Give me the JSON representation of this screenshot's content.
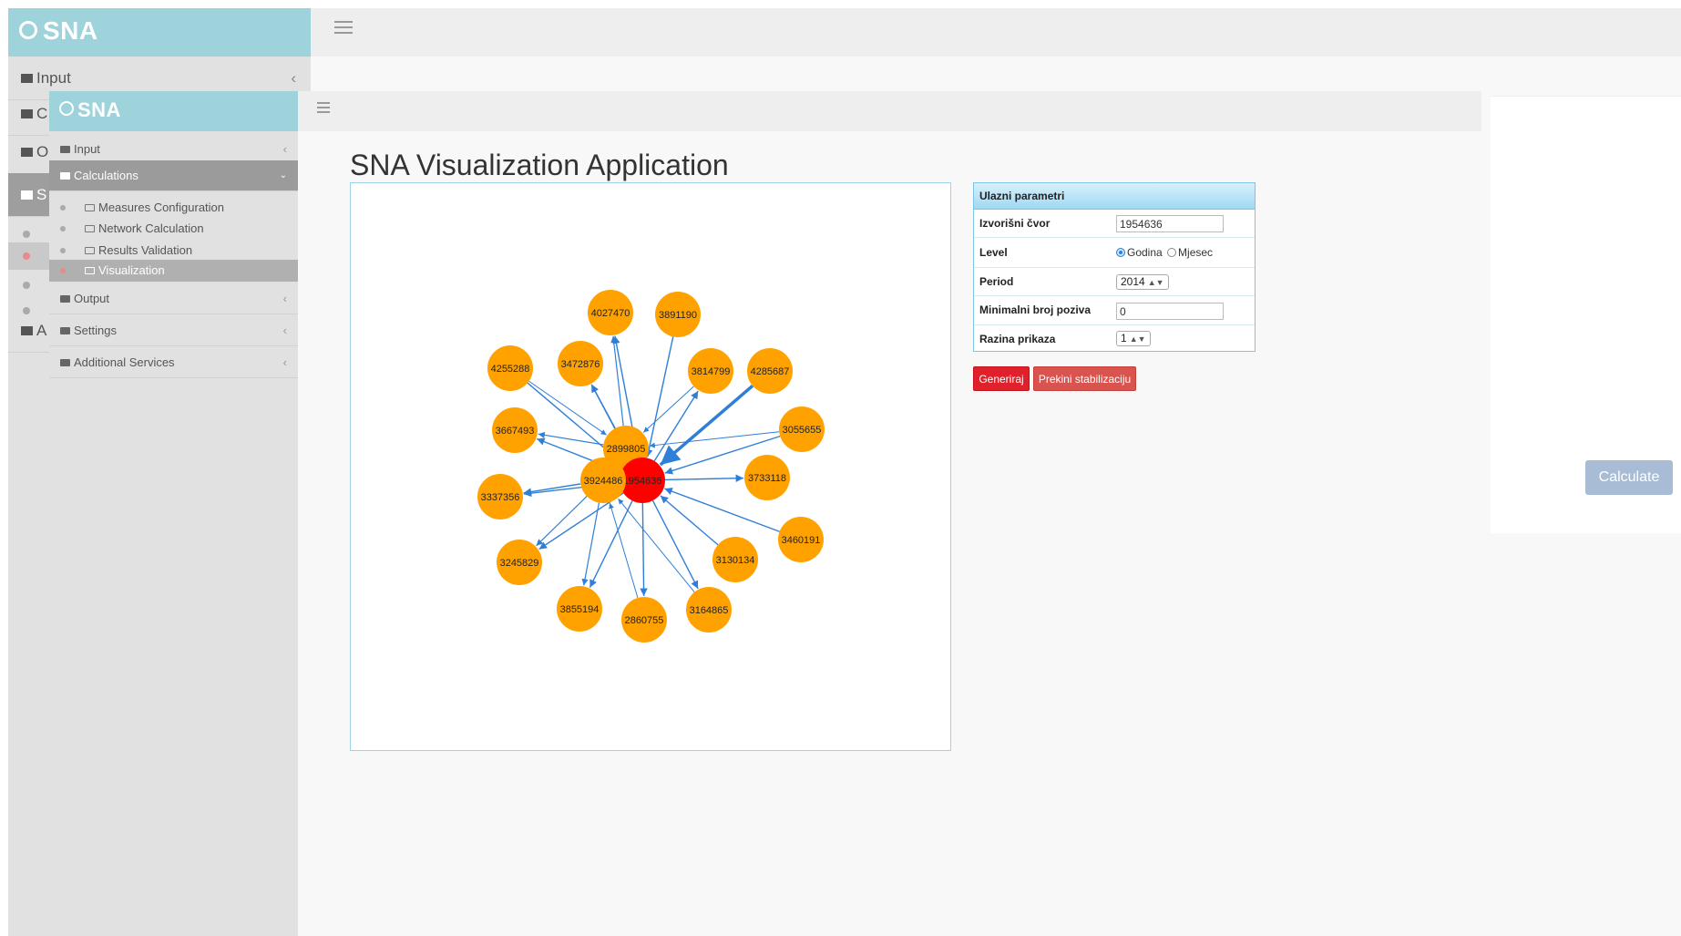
{
  "app": {
    "logo_text": "SNA",
    "page_title": "SNA Visualization Application"
  },
  "background_window": {
    "sidebar": [
      {
        "label": "Input"
      },
      {
        "label": "C"
      },
      {
        "label": "O"
      },
      {
        "label": "S"
      },
      {
        "label": "A"
      }
    ],
    "calculate_label": "Calculate"
  },
  "sidebar": {
    "items": [
      {
        "label": "Input",
        "expanded": false
      },
      {
        "label": "Calculations",
        "expanded": true
      },
      {
        "label": "Output",
        "expanded": false
      },
      {
        "label": "Settings",
        "expanded": false
      },
      {
        "label": "Additional Services",
        "expanded": false
      }
    ],
    "sub_items": [
      {
        "label": "Measures Configuration"
      },
      {
        "label": "Network Calculation"
      },
      {
        "label": "Results Validation"
      },
      {
        "label": "Visualization",
        "active": true
      }
    ]
  },
  "params": {
    "title": "Ulazni parametri",
    "source_node_label": "Izvorišni čvor",
    "source_node_value": "1954636",
    "level_label": "Level",
    "level_options": [
      "Godina",
      "Mjesec"
    ],
    "level_selected": "Godina",
    "period_label": "Period",
    "period_value": "2014",
    "min_calls_label": "Minimalni broj poziva",
    "min_calls_value": "0",
    "display_level_label": "Razina prikaza",
    "display_level_value": "1"
  },
  "buttons": {
    "generate": "Generiraj",
    "stop_stabilization": "Prekini stabilizaciju"
  },
  "graph": {
    "center": {
      "id": "1954636",
      "color": "#ff0000"
    },
    "node_color": "#ffa200",
    "edge_color": "#2f7fd8",
    "nodes": [
      {
        "id": "4027470"
      },
      {
        "id": "3891190"
      },
      {
        "id": "4255288"
      },
      {
        "id": "3472876"
      },
      {
        "id": "3814799"
      },
      {
        "id": "4285687"
      },
      {
        "id": "3667493"
      },
      {
        "id": "2899805"
      },
      {
        "id": "3055655"
      },
      {
        "id": "3924486"
      },
      {
        "id": "3733118"
      },
      {
        "id": "3337356"
      },
      {
        "id": "3460191"
      },
      {
        "id": "3245829"
      },
      {
        "id": "3130134"
      },
      {
        "id": "3855194"
      },
      {
        "id": "2860755"
      },
      {
        "id": "3164865"
      }
    ]
  }
}
